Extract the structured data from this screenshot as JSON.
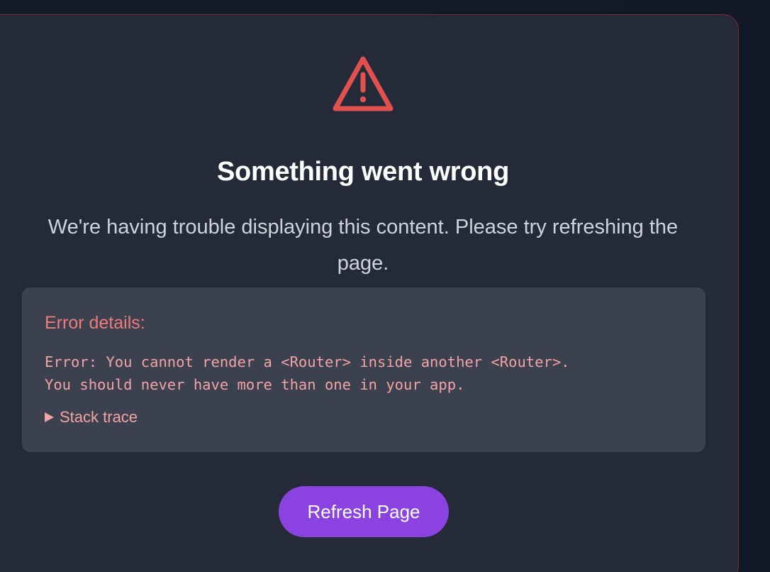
{
  "error_card": {
    "title": "Something went wrong",
    "message": "We're having trouble displaying this content. Please try refreshing the page.",
    "icon": "warning-triangle-icon"
  },
  "details": {
    "heading": "Error details:",
    "error_text": "Error: You cannot render a <Router> inside another <Router>.\nYou should never have more than one in your app.",
    "stack_trace_label": "Stack trace"
  },
  "actions": {
    "refresh_label": "Refresh Page"
  },
  "colors": {
    "page_background": "#151b29",
    "card_background": "#242a38",
    "card_border": "#7a2a33",
    "warning_icon": "#e0504f",
    "details_background": "#3c4150",
    "details_heading": "#ef7b7b",
    "details_text": "#f2a3a3",
    "button_background": "#8a42e0"
  }
}
